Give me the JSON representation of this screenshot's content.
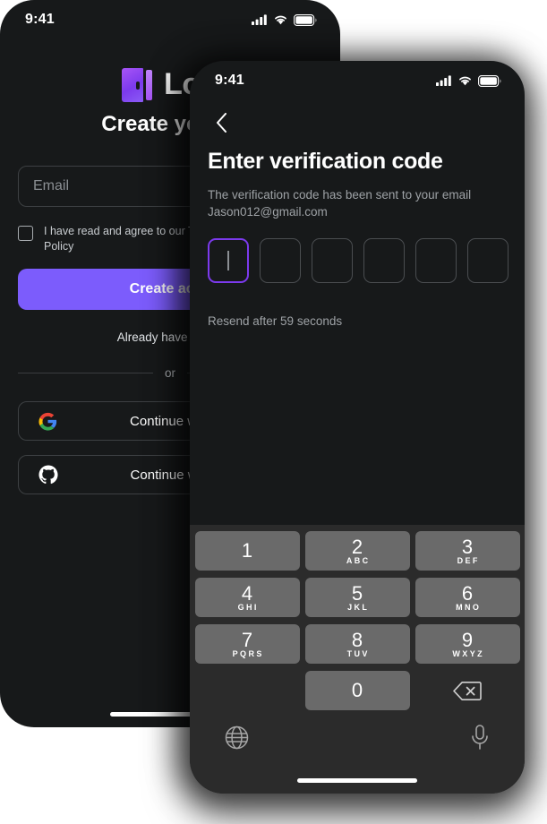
{
  "colors": {
    "screen_bg": "#17191a",
    "accent_purple": "#7c5cfc",
    "otp_focus": "#7c3aed",
    "keyboard_bg": "#2b2b2b",
    "key_bg": "#6a6a6a",
    "border": "#3d4043",
    "muted_text": "#9ea2a6"
  },
  "signup_screen": {
    "status_bar": {
      "time": "9:41",
      "icons": [
        "cellular-signal-icon",
        "wifi-icon",
        "battery-icon"
      ]
    },
    "logo": {
      "icon": "door-logo-icon",
      "text": "Log"
    },
    "heading": "Create your a",
    "email_field": {
      "placeholder": "Email",
      "value": ""
    },
    "agreement": {
      "checked": false,
      "text": "I have read and agree to our T",
      "text_line2": "Policy"
    },
    "primary_button": "Create acco",
    "already_account": "Already have accou",
    "divider_label": "or",
    "social_buttons": [
      {
        "icon": "google-icon",
        "label": "Continue with"
      },
      {
        "icon": "github-icon",
        "label": "Continue with"
      }
    ]
  },
  "verification_screen": {
    "status_bar": {
      "time": "9:41",
      "icons": [
        "cellular-signal-icon",
        "wifi-icon",
        "battery-icon"
      ]
    },
    "back_icon": "chevron-left-icon",
    "title": "Enter verification code",
    "subtitle_line1": "The verification code has been sent to your email",
    "subtitle_line2": "Jason012@gmail.com",
    "otp": {
      "length": 6,
      "active_index": 0,
      "digits": [
        "",
        "",
        "",
        "",
        "",
        ""
      ]
    },
    "resend_text": "Resend after 59 seconds",
    "keyboard": {
      "rows": [
        [
          {
            "num": "1",
            "letters": ""
          },
          {
            "num": "2",
            "letters": "ABC"
          },
          {
            "num": "3",
            "letters": "DEF"
          }
        ],
        [
          {
            "num": "4",
            "letters": "GHI"
          },
          {
            "num": "5",
            "letters": "JKL"
          },
          {
            "num": "6",
            "letters": "MNO"
          }
        ],
        [
          {
            "num": "7",
            "letters": "PQRS"
          },
          {
            "num": "8",
            "letters": "TUV"
          },
          {
            "num": "9",
            "letters": "WXYZ"
          }
        ]
      ],
      "zero": {
        "num": "0",
        "letters": ""
      },
      "delete_icon": "backspace-delete-icon",
      "globe_icon": "globe-language-icon",
      "mic_icon": "microphone-dictation-icon"
    }
  }
}
